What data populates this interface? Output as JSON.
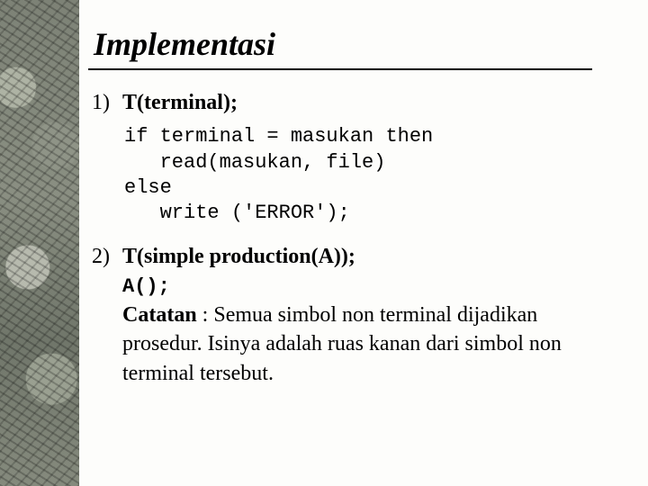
{
  "title": "Implementasi",
  "items": [
    {
      "num": "1)",
      "head": "T(terminal);",
      "code": "if terminal = masukan then\n   read(masukan, file)\nelse\n   write ('ERROR');"
    },
    {
      "num": "2)",
      "head": "T(simple production(A));",
      "call": "A();",
      "note_label": "Catatan",
      "note_rest": " : Semua simbol non terminal dijadikan prosedur. Isinya adalah ruas kanan dari simbol non terminal tersebut."
    }
  ]
}
